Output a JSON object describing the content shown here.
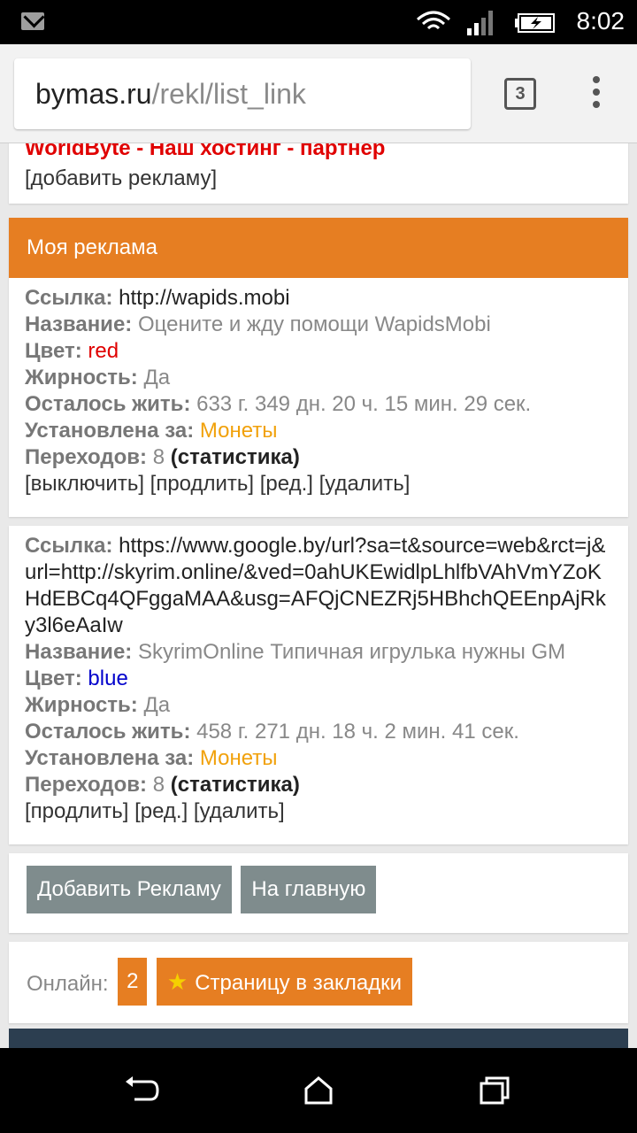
{
  "status": {
    "time": "8:02"
  },
  "browser": {
    "host": "bymas.ru",
    "path": "/rekl/list_link",
    "tab_count": "3"
  },
  "partner": {
    "title": "WorldByte - Наш хостинг - партнер",
    "add_link": "[добавить рекламу]"
  },
  "section_title": "Моя реклама",
  "ads": [
    {
      "link_label": "Ссылка:",
      "link": "http://wapids.mobi",
      "name_label": "Название:",
      "name": "Оцените и жду помощи WapidsMobi",
      "color_label": "Цвет:",
      "color": "red",
      "bold_label": "Жирность:",
      "bold": "Да",
      "life_label": "Осталось жить:",
      "life": "633 г. 349 дн. 20 ч. 15 мин. 29 сек.",
      "paid_label": "Установлена за:",
      "paid": "Монеты",
      "clicks_label": "Переходов:",
      "clicks": "8",
      "stats": "(статистика)",
      "actions": "[выключить] [продлить] [ред.] [удалить]"
    },
    {
      "link_label": "Ссылка:",
      "link": "https://www.google.by/url?sa=t&source=web&rct=j&url=http://skyrim.online/&ved=0ahUKEwidlpLhlfbVAhVmYZoKHdEBCq4QFggaMAA&usg=AFQjCNEZRj5HBhchQEEnpAjRky3l6eAaIw",
      "name_label": "Название:",
      "name": "SkyrimOnline Типичная игрулька нужны GM",
      "color_label": "Цвет:",
      "color": "blue",
      "bold_label": "Жирность:",
      "bold": "Да",
      "life_label": "Осталось жить:",
      "life": "458 г. 271 дн. 18 ч. 2 мин. 41 сек.",
      "paid_label": "Установлена за:",
      "paid": "Монеты",
      "clicks_label": "Переходов:",
      "clicks": "8",
      "stats": "(статистика)",
      "actions": "[продлить] [ред.] [удалить]"
    }
  ],
  "buttons": {
    "add": "Добавить Рекламу",
    "home": "На главную"
  },
  "online": {
    "label": "Онлайн:",
    "count": "2",
    "bookmark": "Страницу в закладки"
  },
  "colors": {
    "accent": "#e67e22",
    "button_gray": "#7f8c8d",
    "red": "#e00000",
    "blue": "#0000cc",
    "coins": "#f1a10b"
  }
}
